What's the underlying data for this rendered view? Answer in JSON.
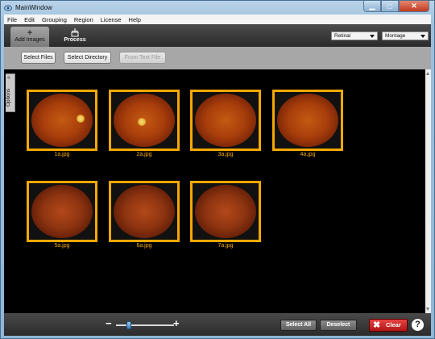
{
  "window": {
    "title": "MainWindow"
  },
  "menu": [
    "File",
    "Edit",
    "Grouping",
    "Region",
    "License",
    "Help"
  ],
  "tabs": [
    {
      "label": "Add Images",
      "icon": "plus-icon"
    },
    {
      "label": "Process",
      "icon": "cake-icon"
    }
  ],
  "dropdowns": {
    "mode": "Retinal",
    "view": "Montage"
  },
  "buttons": {
    "select_files": "Select Files",
    "select_directory": "Select Directory",
    "from_text_file": "From Text File"
  },
  "side_panel": {
    "label": "Options"
  },
  "images": [
    {
      "name": "1a.jpg"
    },
    {
      "name": "2a.jpg"
    },
    {
      "name": "3a.jpg"
    },
    {
      "name": "4a.jpg"
    },
    {
      "name": "5a.jpg"
    },
    {
      "name": "6a.jpg"
    },
    {
      "name": "7a.jpg"
    }
  ],
  "bottom": {
    "zoom_minus": "−",
    "zoom_plus": "+",
    "select_all": "Select All",
    "deselect": "Deselect",
    "clear": "Clear",
    "help": "?"
  },
  "colors": {
    "selection": "#f5a800",
    "clear": "#c8201e",
    "canvas": "#000000"
  }
}
